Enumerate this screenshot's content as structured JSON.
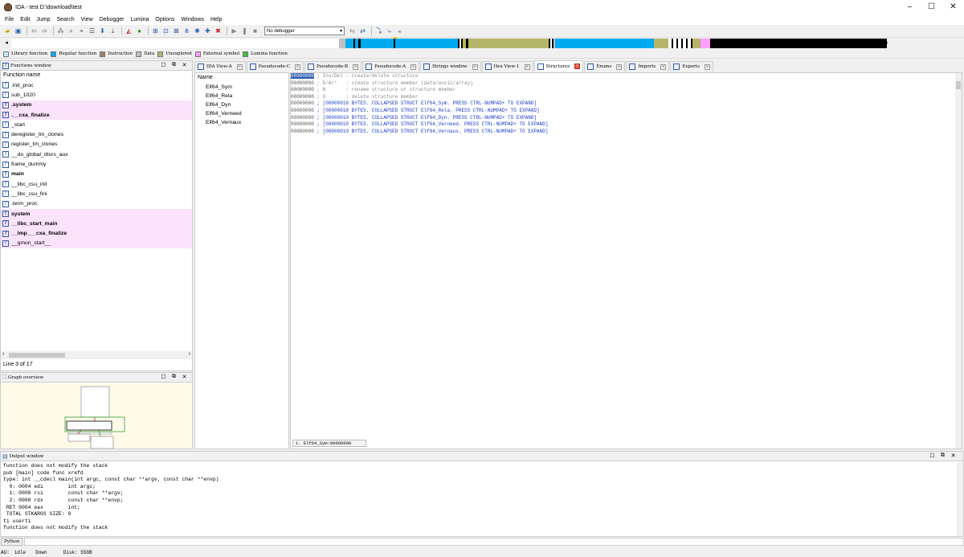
{
  "window": {
    "title": "IDA - test D:\\download\\test",
    "minimize": "–",
    "maximize": "☐",
    "close": "✕"
  },
  "menu": [
    "File",
    "Edit",
    "Jump",
    "Search",
    "View",
    "Debugger",
    "Lumina",
    "Options",
    "Windows",
    "Help"
  ],
  "toolbar": {
    "debugger_select": "No debugger"
  },
  "navband": {
    "colors": {
      "library": "#c8ecff",
      "regular": "#00aaee",
      "instruction": "#a0826d",
      "data": "#c0c0c0",
      "unexplored": "#b5b56a",
      "external": "#ff9fff",
      "lumina": "#40c040",
      "black": "#000000"
    }
  },
  "legend": [
    {
      "label": "Library function",
      "color": "#c8ecff"
    },
    {
      "label": "Regular function",
      "color": "#00aaee"
    },
    {
      "label": "Instruction",
      "color": "#a0826d"
    },
    {
      "label": "Data",
      "color": "#c0c0c0"
    },
    {
      "label": "Unexplored",
      "color": "#b5b56a"
    },
    {
      "label": "External symbol",
      "color": "#ff9fff"
    },
    {
      "label": "Lumina function",
      "color": "#40c040"
    }
  ],
  "functions_window": {
    "title": "Functions window",
    "column_header": "Function name",
    "items": [
      {
        "name": ".init_proc",
        "pink": false,
        "bold": false
      },
      {
        "name": "sub_1020",
        "pink": false,
        "bold": false
      },
      {
        "name": ".system",
        "pink": true,
        "bold": true
      },
      {
        "name": ".__cxa_finalize",
        "pink": true,
        "bold": true
      },
      {
        "name": "_start",
        "pink": false,
        "bold": false
      },
      {
        "name": "deregister_tm_clones",
        "pink": false,
        "bold": false
      },
      {
        "name": "register_tm_clones",
        "pink": false,
        "bold": false
      },
      {
        "name": "__do_global_dtors_aux",
        "pink": false,
        "bold": false
      },
      {
        "name": "frame_dummy",
        "pink": false,
        "bold": false
      },
      {
        "name": "main",
        "pink": false,
        "bold": true
      },
      {
        "name": "__libc_csu_init",
        "pink": false,
        "bold": false
      },
      {
        "name": "__libc_csu_fini",
        "pink": false,
        "bold": false
      },
      {
        "name": ".term_proc",
        "pink": false,
        "bold": false
      },
      {
        "name": "system",
        "pink": true,
        "bold": true
      },
      {
        "name": "__libc_start_main",
        "pink": true,
        "bold": true
      },
      {
        "name": "__imp___cxa_finalize",
        "pink": true,
        "bold": true
      },
      {
        "name": "__gmon_start__",
        "pink": true,
        "bold": false
      }
    ],
    "line_status": "Line 3 of 17"
  },
  "graph_overview": {
    "title": "Graph overview"
  },
  "tabs": [
    {
      "label": "IDA View-A",
      "active": false
    },
    {
      "label": "Pseudocode-C",
      "active": false
    },
    {
      "label": "Pseudocode-B",
      "active": false
    },
    {
      "label": "Pseudocode-A",
      "active": false
    },
    {
      "label": "Strings window",
      "active": false
    },
    {
      "label": "Hex View-1",
      "active": false
    },
    {
      "label": "Structures",
      "active": true
    },
    {
      "label": "Enums",
      "active": false
    },
    {
      "label": "Imports",
      "active": false
    },
    {
      "label": "Exports",
      "active": false
    }
  ],
  "structures": {
    "name_header": "Name",
    "names": [
      "Elf64_Sym",
      "Elf64_Rela",
      "Elf64_Dyn",
      "Elf64_Verneed",
      "Elf64_Vernaux"
    ],
    "lines": [
      {
        "addr": "00000000",
        "text": " ; Ins/Del : create/delete structure",
        "kind": "cmt",
        "current": true
      },
      {
        "addr": "00000000",
        "text": " ; D/A/*   : create structure member (data/ascii/array)",
        "kind": "cmt",
        "current": false
      },
      {
        "addr": "00000000",
        "text": " ; N       : rename structure or structure member",
        "kind": "cmt",
        "current": false
      },
      {
        "addr": "00000000",
        "text": " ; U       : delete structure member",
        "kind": "cmt",
        "current": false
      },
      {
        "addr": "00000000",
        "text": " ; [00000018 BYTES. COLLAPSED STRUCT Elf64_Sym. PRESS CTRL-NUMPAD+ TO EXPAND]",
        "kind": "blue",
        "current": false
      },
      {
        "addr": "00000000",
        "text": " ; [00000018 BYTES. COLLAPSED STRUCT Elf64_Rela. PRESS CTRL-NUMPAD+ TO EXPAND]",
        "kind": "blue",
        "current": false
      },
      {
        "addr": "00000000",
        "text": " ; [00000010 BYTES. COLLAPSED STRUCT Elf64_Dyn. PRESS CTRL-NUMPAD+ TO EXPAND]",
        "kind": "blue",
        "current": false
      },
      {
        "addr": "00000000",
        "text": " ; [00000010 BYTES. COLLAPSED STRUCT Elf64_Verneed. PRESS CTRL-NUMPAD+ TO EXPAND]",
        "kind": "blue",
        "current": false
      },
      {
        "addr": "00000000",
        "text": " ; [00000010 BYTES. COLLAPSED STRUCT Elf64_Vernaux. PRESS CTRL-NUMPAD+ TO EXPAND]",
        "kind": "blue",
        "current": false
      }
    ],
    "status": "1. Elf64_Sym:00000000"
  },
  "output_window": {
    "title": "Output window",
    "lines": [
      "function does not modify the stack",
      "pub [main] code func xrefd",
      "type: int __cdecl main(int argc, const char **argv, const char **envp)",
      "  0: 0004 edi        int argc;",
      "  1: 0008 rsi        const char **argv;",
      "  2: 0008 rdx        const char **envp;",
      " RET 0004 eax        int;",
      " TOTAL STKARGS SIZE: 0",
      "ti userti",
      "function does not modify the stack"
    ]
  },
  "python_label": "Python",
  "status_bar": {
    "au": "AU:",
    "state": "idle",
    "direction": "Down",
    "disk": "Disk: 55GB"
  }
}
